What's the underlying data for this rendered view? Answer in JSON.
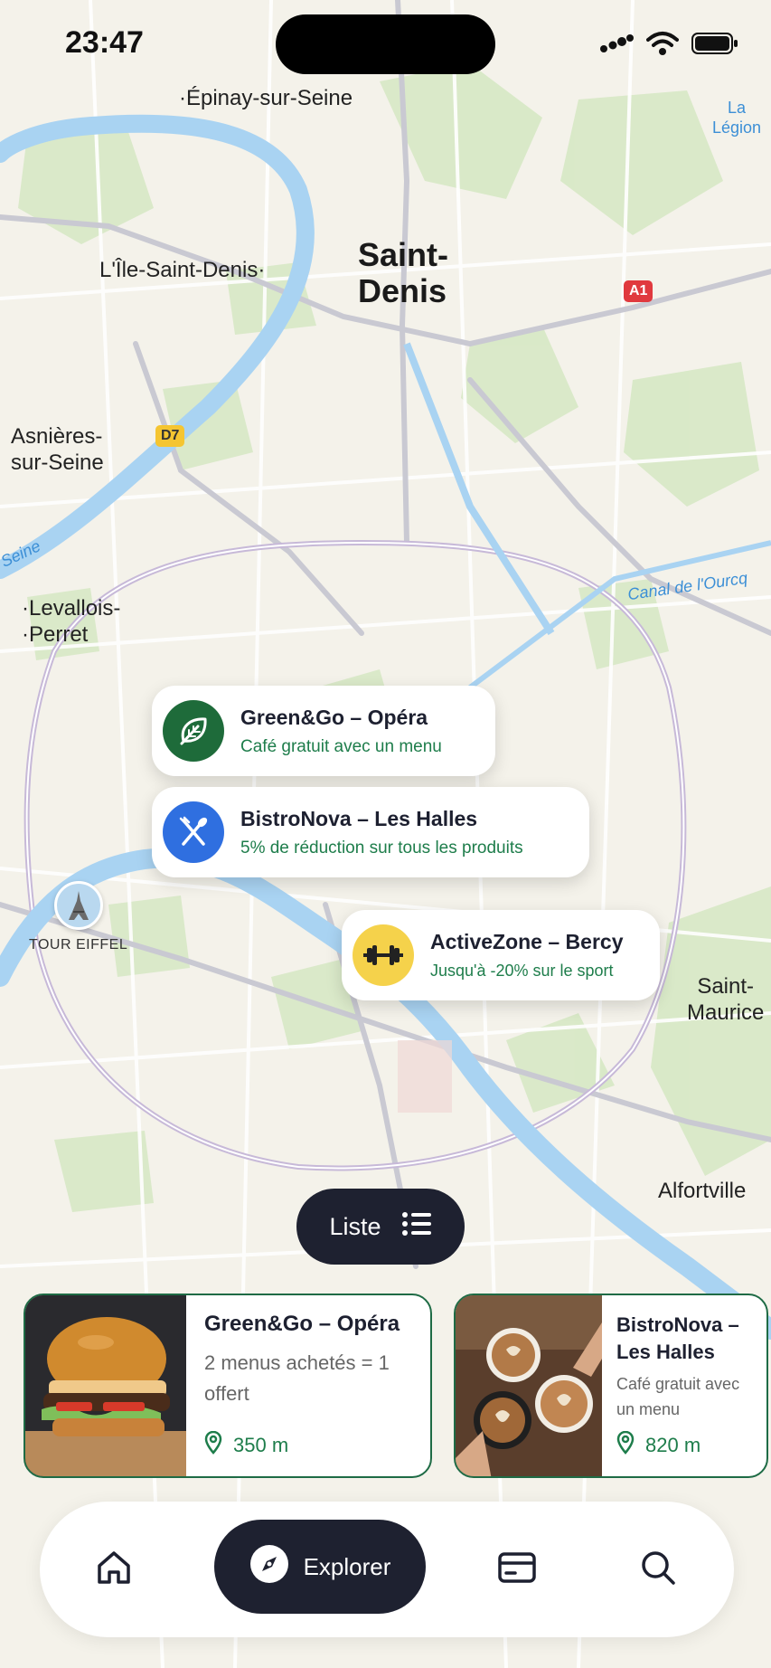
{
  "status": {
    "time": "23:47"
  },
  "map": {
    "labels": {
      "epinay": "·Épinay-sur-Seine",
      "legion": "La\nLégion",
      "ile_saint_denis": "L'Île-Saint-Denis·",
      "saint_denis": "Saint-\nDenis",
      "asnieres": "Asnières-\nsur-Seine",
      "levallois": "·Levallois-\n·Perret",
      "canal": "Canal de l'Ourcq",
      "seine": "Seine",
      "tour_eiffel": "TOUR EIFFEL",
      "saint_maurice": "Saint-\nMaurice",
      "alfortville": "Alfortville"
    },
    "road_badges": {
      "a1": "A1",
      "d7": "D7"
    }
  },
  "pins": [
    {
      "title": "Green&Go – Opéra",
      "offer": "Café gratuit avec un menu",
      "icon": "leaf-icon",
      "color": "#1e6b3a"
    },
    {
      "title": "BistroNova – Les Halles",
      "offer": "5% de réduction sur tous les produits",
      "icon": "utensils-icon",
      "color": "#2f6fe0"
    },
    {
      "title": "ActiveZone – Bercy",
      "offer": "Jusqu'à -20% sur le sport",
      "icon": "dumbbell-icon",
      "color": "#f5d24b"
    }
  ],
  "list_button": {
    "label": "Liste",
    "icon": "list-icon"
  },
  "cards": [
    {
      "title": "Green&Go – Opéra",
      "description": "2 menus achetés = 1 offert",
      "distance": "350 m",
      "image": "burger-photo"
    },
    {
      "title": "BistroNova – Les Halles",
      "description": "Café gratuit avec un menu",
      "distance": "820 m",
      "image": "coffee-cups-photo"
    }
  ],
  "nav": {
    "items": [
      {
        "name": "home-icon"
      },
      {
        "name": "explore-icon",
        "label": "Explorer",
        "active": true
      },
      {
        "name": "wallet-icon"
      },
      {
        "name": "search-icon"
      }
    ]
  },
  "colors": {
    "accent_dark": "#1e2130",
    "offer_green": "#1e7d4b",
    "card_border": "#1e6b45"
  }
}
